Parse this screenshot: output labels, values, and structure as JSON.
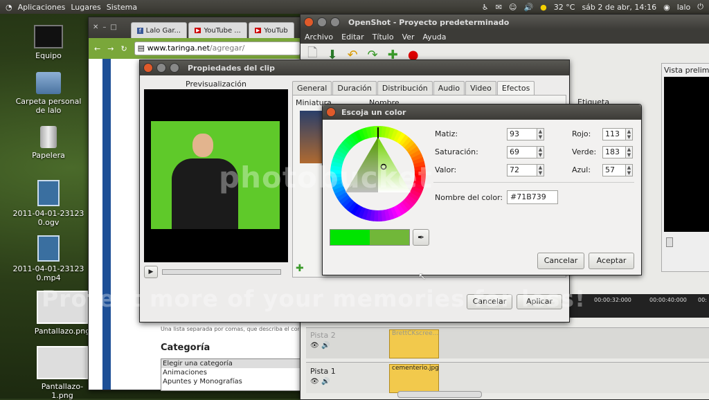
{
  "panel": {
    "menus": [
      "Aplicaciones",
      "Lugares",
      "Sistema"
    ],
    "temperature": "32 °C",
    "datetime": "sáb 2 de abr, 14:16",
    "user": "lalo"
  },
  "desktop_icons": [
    {
      "label": "Equipo"
    },
    {
      "label": "Carpeta personal de lalo"
    },
    {
      "label": "Papelera"
    },
    {
      "label": "2011-04-01-231230.ogv"
    },
    {
      "label": "2011-04-01-231230.mp4"
    },
    {
      "label": "Pantallazo.png"
    },
    {
      "label": "Pantallazo-1.png"
    }
  ],
  "browser": {
    "tabs": [
      "Lalo Gar...",
      "YouTube ...",
      "YouTub"
    ],
    "url_domain": "www.taringa.net",
    "url_path": "/agregar/",
    "hint_text": "Una lista separada por comas, que describa el conte",
    "category_heading": "Categoría",
    "category_options": [
      "Elegir una categoría",
      "Animaciones",
      "Apuntes y Monografías"
    ]
  },
  "openshot": {
    "title": "OpenShot - Proyecto predeterminado",
    "menu": [
      "Archivo",
      "Editar",
      "Título",
      "Ver",
      "Ayuda"
    ],
    "preview_label": "Vista prelimi",
    "column_label": "Etiqueta",
    "timecodes": [
      "00:00:32:000",
      "00:00:40:000",
      "00:"
    ],
    "tracks": [
      {
        "name": "Pista 2",
        "clip": "BrettCKscree..."
      },
      {
        "name": "Pista 1",
        "clip": "cementerio.jpg"
      }
    ]
  },
  "clip_props": {
    "title": "Propiedades del clip",
    "preview_label": "Previsualización",
    "tabs": [
      "General",
      "Duración",
      "Distribución",
      "Audio",
      "Video",
      "Efectos"
    ],
    "active_tab": "Efectos",
    "col_thumb": "Miniatura",
    "col_name": "Nombre",
    "cancel": "Cancelar",
    "apply": "Aplicar"
  },
  "color_dialog": {
    "title": "Escoja un color",
    "hue_label": "Matiz:",
    "hue": "93",
    "sat_label": "Saturación:",
    "sat": "69",
    "val_label": "Valor:",
    "val": "72",
    "red_label": "Rojo:",
    "red": "113",
    "green_label": "Verde:",
    "green": "183",
    "blue_label": "Azul:",
    "blue": "57",
    "name_label": "Nombre del color:",
    "name": "#71B739",
    "cancel": "Cancelar",
    "accept": "Aceptar",
    "current_color": "#71B739",
    "previous_color": "#00E400"
  },
  "watermark": {
    "logo": "photobucket",
    "text": "Protect more of your memories for less!"
  }
}
